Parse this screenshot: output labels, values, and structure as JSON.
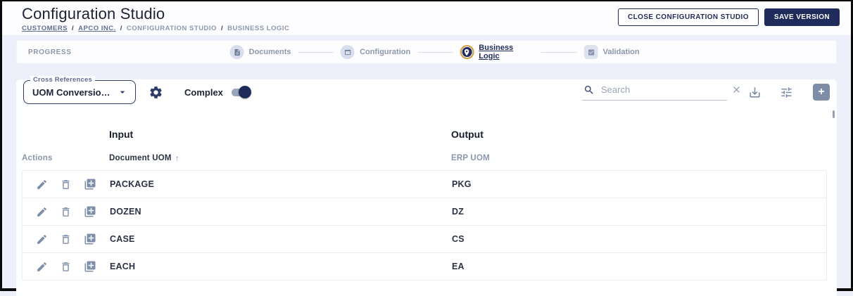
{
  "header": {
    "title": "Configuration Studio",
    "breadcrumb": [
      {
        "label": "CUSTOMERS"
      },
      {
        "label": "APCO INC."
      },
      {
        "label": "CONFIGURATION STUDIO"
      },
      {
        "label": "BUSINESS LOGIC"
      }
    ],
    "breadcrumb_separator": "/",
    "close_button": "CLOSE CONFIGURATION STUDIO",
    "save_button": "SAVE VERSION"
  },
  "progress": {
    "label": "PROGRESS",
    "steps": [
      {
        "label": "Documents",
        "icon": "document-icon",
        "state": "inactive"
      },
      {
        "label": "Configuration",
        "icon": "window-icon",
        "state": "inactive"
      },
      {
        "label": "Business Logic",
        "icon": "pin-icon",
        "state": "active"
      },
      {
        "label": "Validation",
        "icon": "checkbox-icon",
        "state": "inactive"
      }
    ]
  },
  "toolbar": {
    "dropdown_label": "Cross References",
    "dropdown_value": "UOM Conversio…",
    "complex_label": "Complex",
    "complex_on": true,
    "search_placeholder": "Search",
    "search_value": "",
    "add_button_glyph": "+"
  },
  "table": {
    "group_headers": {
      "input": "Input",
      "output": "Output"
    },
    "columns": {
      "actions": "Actions",
      "input": "Document UOM",
      "output": "ERP UOM"
    },
    "sort_icon": "↑",
    "rows": [
      {
        "input": "PACKAGE",
        "output": "PKG"
      },
      {
        "input": "DOZEN",
        "output": "DZ"
      },
      {
        "input": "CASE",
        "output": "CS"
      },
      {
        "input": "EACH",
        "output": "EA"
      }
    ]
  },
  "colors": {
    "accent_navy": "#1f2b5b",
    "slate_icon": "#7f8ea8",
    "gold_ring": "#d3a24a",
    "page_background": "#edeffb"
  }
}
